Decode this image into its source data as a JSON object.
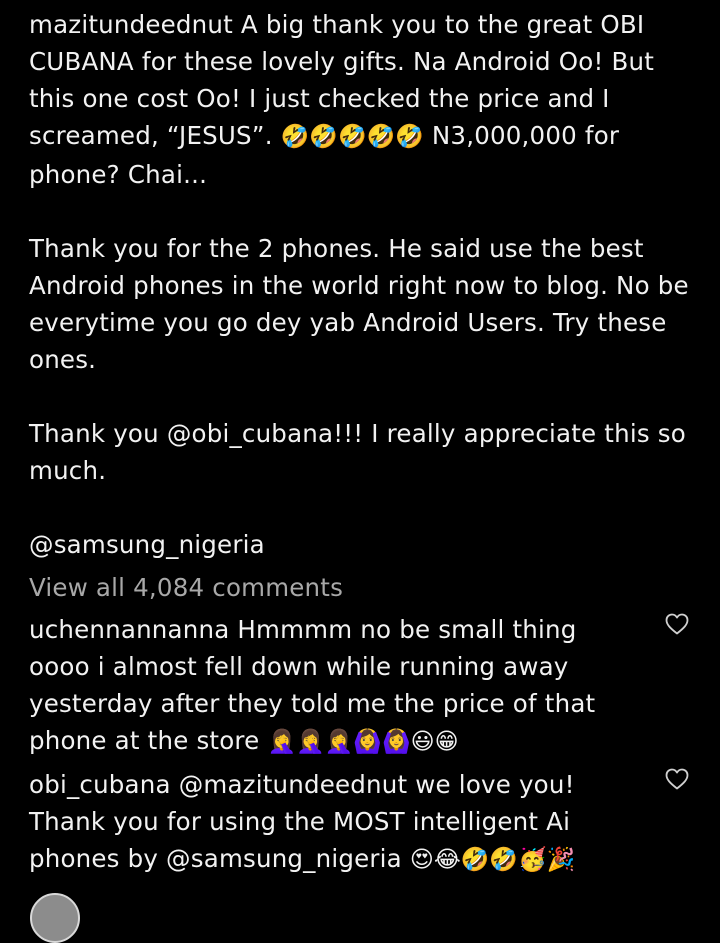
{
  "post": {
    "username": "mazitundeednut",
    "caption_p1": "A big thank you to the great OBI CUBANA for these lovely gifts. Na Android Oo! But this one cost Oo! I just checked the price and I screamed, “JESUS”.",
    "caption_p1_emoji": "🤣🤣🤣🤣🤣",
    "caption_p1_end": "N3,000,000 for phone? Chai...",
    "caption_p2": "Thank you for the 2 phones. He said use the best Android phones in the world right now to blog. No be everytime you go dey yab Android Users. Try these ones.",
    "caption_p3": "Thank you @obi_cubana!!! I really appreciate this so much.",
    "caption_tag": "@samsung_nigeria"
  },
  "comments_link": "View all 4,084 comments",
  "comments": [
    {
      "username": "uchennannanna",
      "text": "Hmmmm no be small thing oooo i almost fell down while running away yesterday after they told me the price of that phone at the store",
      "emoji": "🤦‍♀️🤦‍♀️🤦‍♀️🙆‍♀️🙆‍♀️😃😁"
    },
    {
      "username": "obi_cubana",
      "text": "@mazitundeednut we love you! Thank you for using the MOST intelligent Ai phones by @samsung_nigeria",
      "emoji": "😍😂🤣🤣🥳🎉"
    }
  ],
  "icons": {
    "like": "heart-outline-icon"
  },
  "colors": {
    "background": "#000000",
    "text": "#f2f2f2",
    "muted": "#a8a8a8"
  }
}
